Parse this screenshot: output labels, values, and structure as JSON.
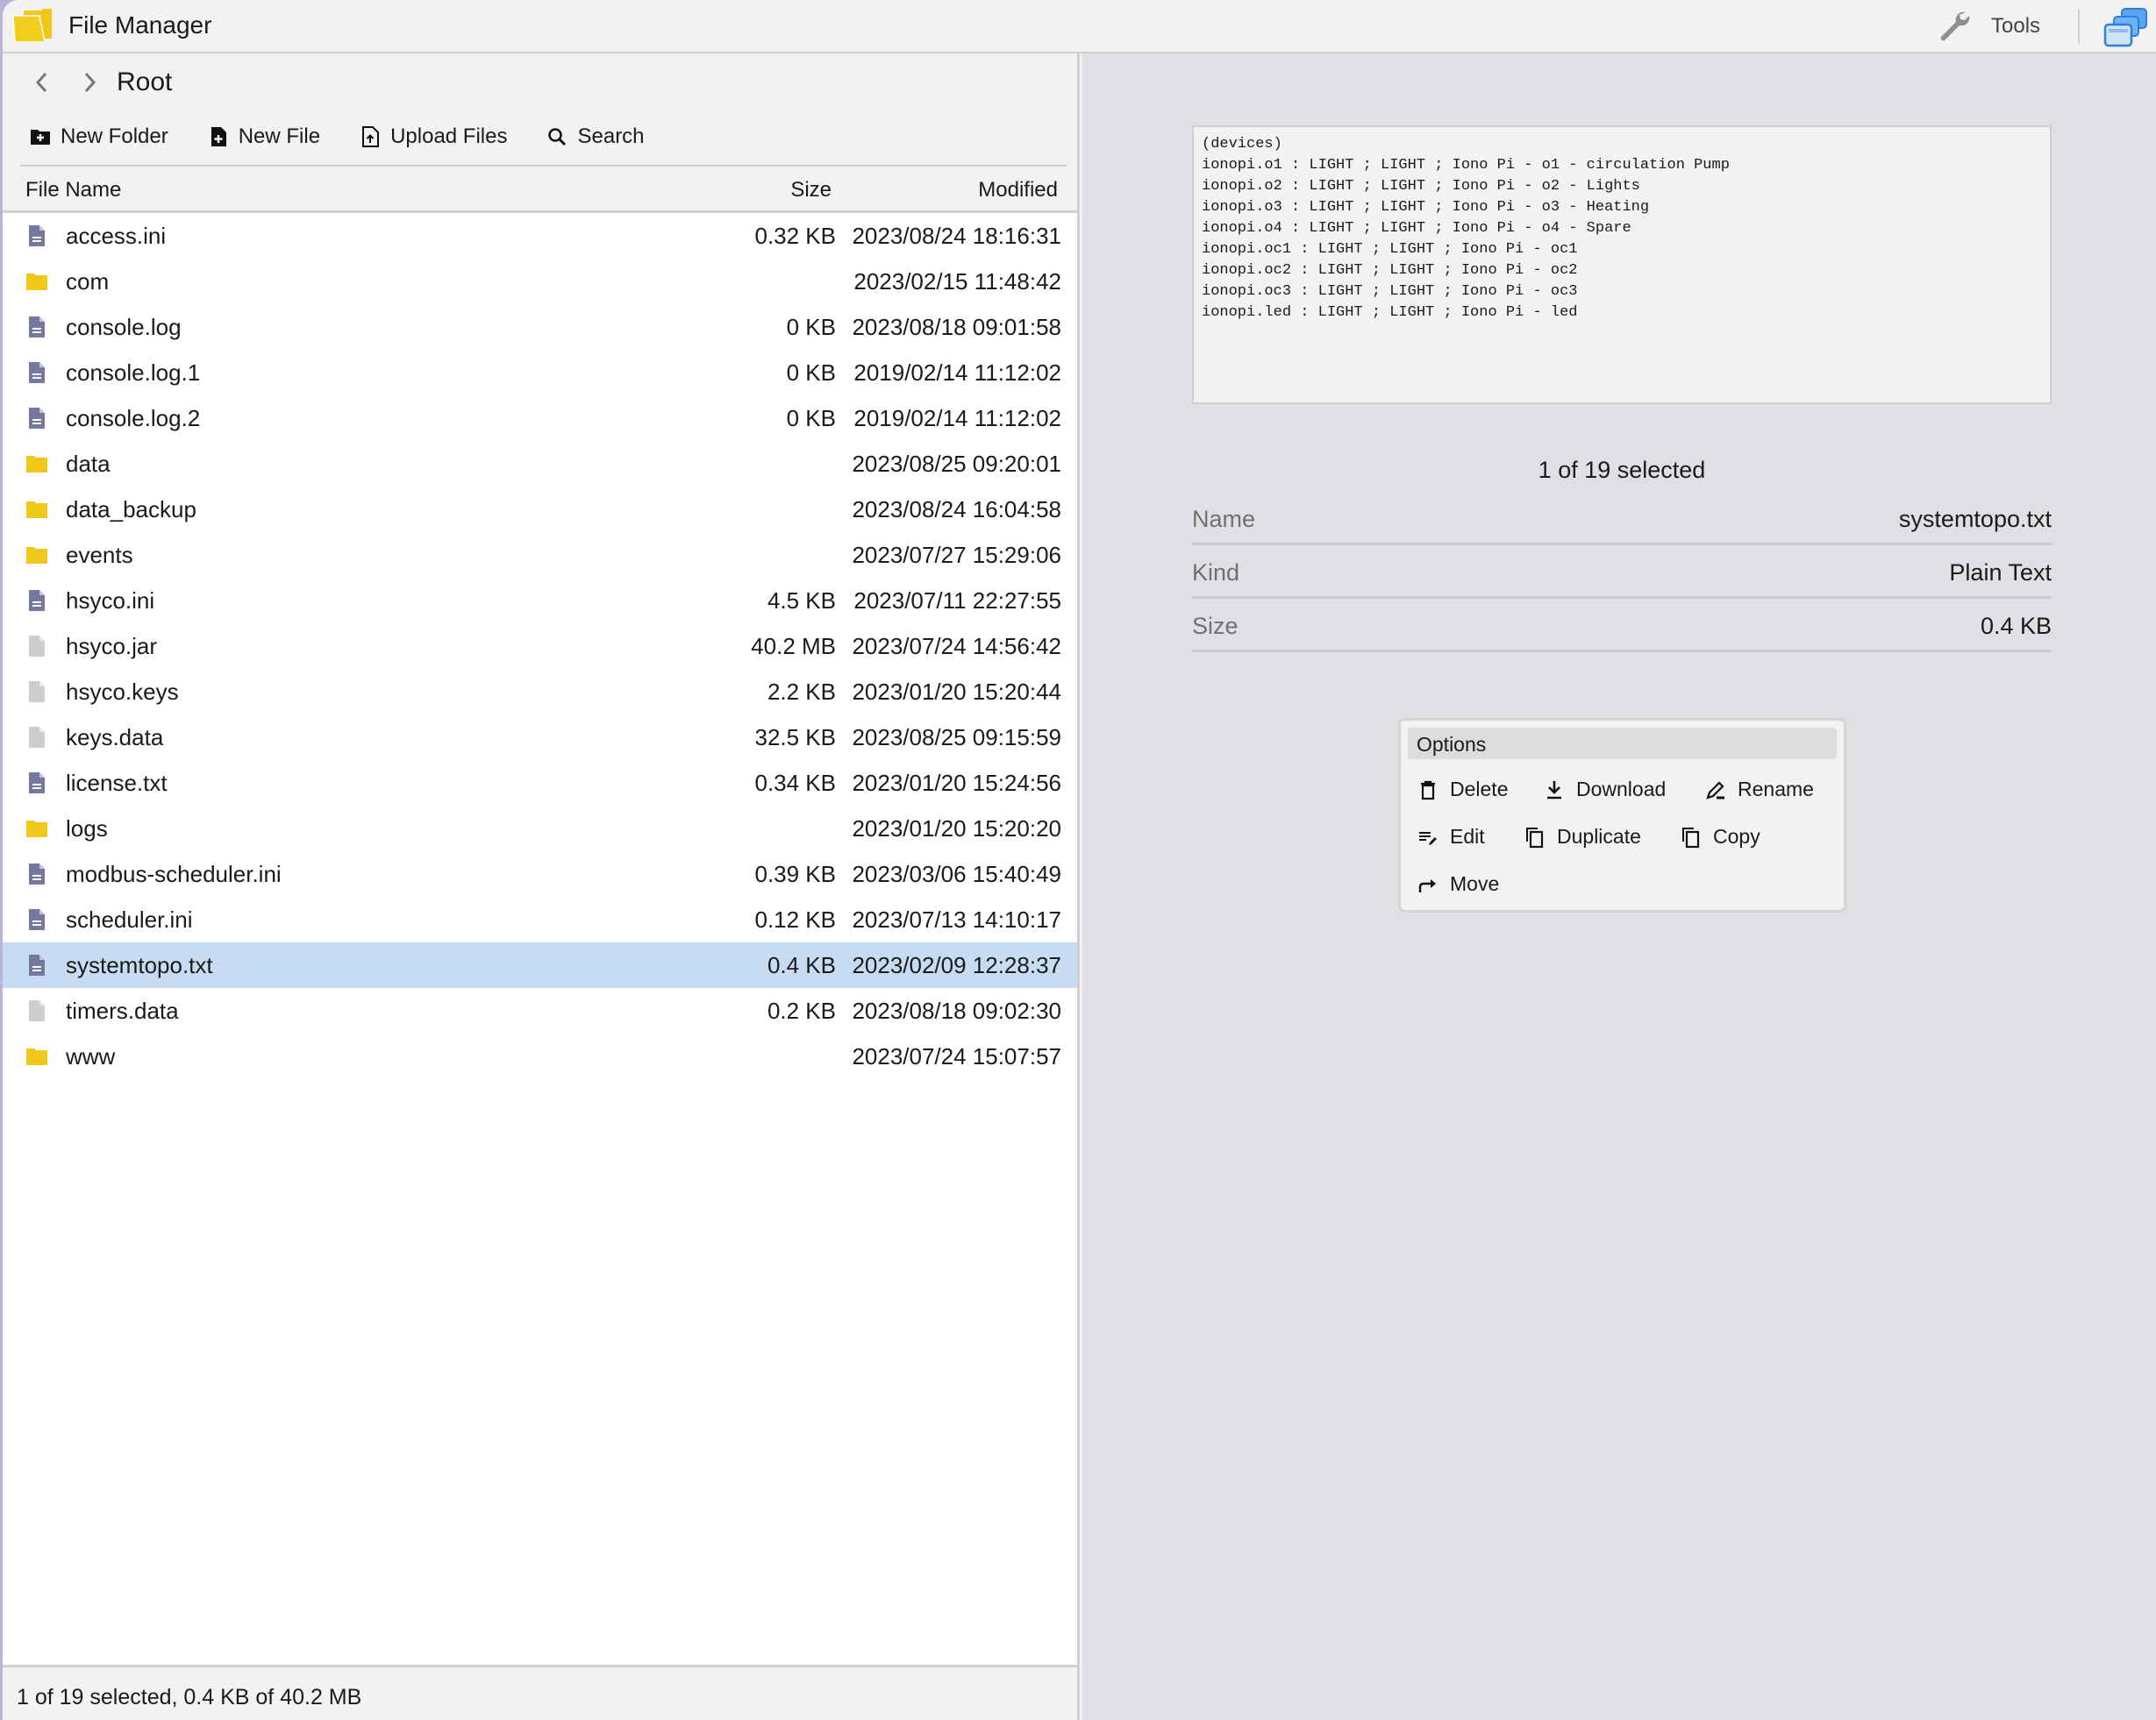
{
  "app": {
    "title": "File Manager",
    "tools_label": "Tools"
  },
  "breadcrumb": {
    "current": "Root"
  },
  "toolbar": {
    "new_folder": "New Folder",
    "new_file": "New File",
    "upload_files": "Upload Files",
    "search": "Search"
  },
  "table": {
    "columns": {
      "name": "File Name",
      "size": "Size",
      "modified": "Modified"
    },
    "rows": [
      {
        "name": "access.ini",
        "size": "0.32 KB",
        "modified": "2023/08/24 18:16:31",
        "type": "text"
      },
      {
        "name": "com",
        "size": "",
        "modified": "2023/02/15 11:48:42",
        "type": "folder"
      },
      {
        "name": "console.log",
        "size": "0 KB",
        "modified": "2023/08/18 09:01:58",
        "type": "text"
      },
      {
        "name": "console.log.1",
        "size": "0 KB",
        "modified": "2019/02/14 11:12:02",
        "type": "text"
      },
      {
        "name": "console.log.2",
        "size": "0 KB",
        "modified": "2019/02/14 11:12:02",
        "type": "text"
      },
      {
        "name": "data",
        "size": "",
        "modified": "2023/08/25 09:20:01",
        "type": "folder"
      },
      {
        "name": "data_backup",
        "size": "",
        "modified": "2023/08/24 16:04:58",
        "type": "folder"
      },
      {
        "name": "events",
        "size": "",
        "modified": "2023/07/27 15:29:06",
        "type": "folder"
      },
      {
        "name": "hsyco.ini",
        "size": "4.5 KB",
        "modified": "2023/07/11 22:27:55",
        "type": "text"
      },
      {
        "name": "hsyco.jar",
        "size": "40.2 MB",
        "modified": "2023/07/24 14:56:42",
        "type": "binary"
      },
      {
        "name": "hsyco.keys",
        "size": "2.2 KB",
        "modified": "2023/01/20 15:20:44",
        "type": "binary"
      },
      {
        "name": "keys.data",
        "size": "32.5 KB",
        "modified": "2023/08/25 09:15:59",
        "type": "binary"
      },
      {
        "name": "license.txt",
        "size": "0.34 KB",
        "modified": "2023/01/20 15:24:56",
        "type": "text"
      },
      {
        "name": "logs",
        "size": "",
        "modified": "2023/01/20 15:20:20",
        "type": "folder"
      },
      {
        "name": "modbus-scheduler.ini",
        "size": "0.39 KB",
        "modified": "2023/03/06 15:40:49",
        "type": "text"
      },
      {
        "name": "scheduler.ini",
        "size": "0.12 KB",
        "modified": "2023/07/13 14:10:17",
        "type": "text"
      },
      {
        "name": "systemtopo.txt",
        "size": "0.4 KB",
        "modified": "2023/02/09 12:28:37",
        "type": "text",
        "selected": true
      },
      {
        "name": "timers.data",
        "size": "0.2 KB",
        "modified": "2023/08/18 09:02:30",
        "type": "binary"
      },
      {
        "name": "www",
        "size": "",
        "modified": "2023/07/24 15:07:57",
        "type": "folder"
      }
    ]
  },
  "status": "1 of 19 selected, 0.4 KB of 40.2 MB",
  "preview": {
    "lines": [
      "(devices)",
      "ionopi.o1 : LIGHT ; LIGHT ; Iono Pi - o1 - circulation Pump",
      "ionopi.o2 : LIGHT ; LIGHT ; Iono Pi - o2 - Lights",
      "ionopi.o3 : LIGHT ; LIGHT ; Iono Pi - o3 - Heating",
      "ionopi.o4 : LIGHT ; LIGHT ; Iono Pi - o4 - Spare",
      "ionopi.oc1 : LIGHT ; LIGHT ; Iono Pi - oc1",
      "ionopi.oc2 : LIGHT ; LIGHT ; Iono Pi - oc2",
      "ionopi.oc3 : LIGHT ; LIGHT ; Iono Pi - oc3",
      "ionopi.led : LIGHT ; LIGHT ; Iono Pi - led"
    ]
  },
  "details": {
    "selection": "1 of 19 selected",
    "name_label": "Name",
    "name_value": "systemtopo.txt",
    "kind_label": "Kind",
    "kind_value": "Plain Text",
    "size_label": "Size",
    "size_value": "0.4 KB"
  },
  "options": {
    "title": "Options",
    "delete": "Delete",
    "download": "Download",
    "rename": "Rename",
    "edit": "Edit",
    "duplicate": "Duplicate",
    "copy": "Copy",
    "move": "Move"
  },
  "colors": {
    "folder": "#f0c81a",
    "text_file": "#7579a0",
    "binary_file": "#cdcdcd",
    "selected_row": "#c7dcf2"
  }
}
